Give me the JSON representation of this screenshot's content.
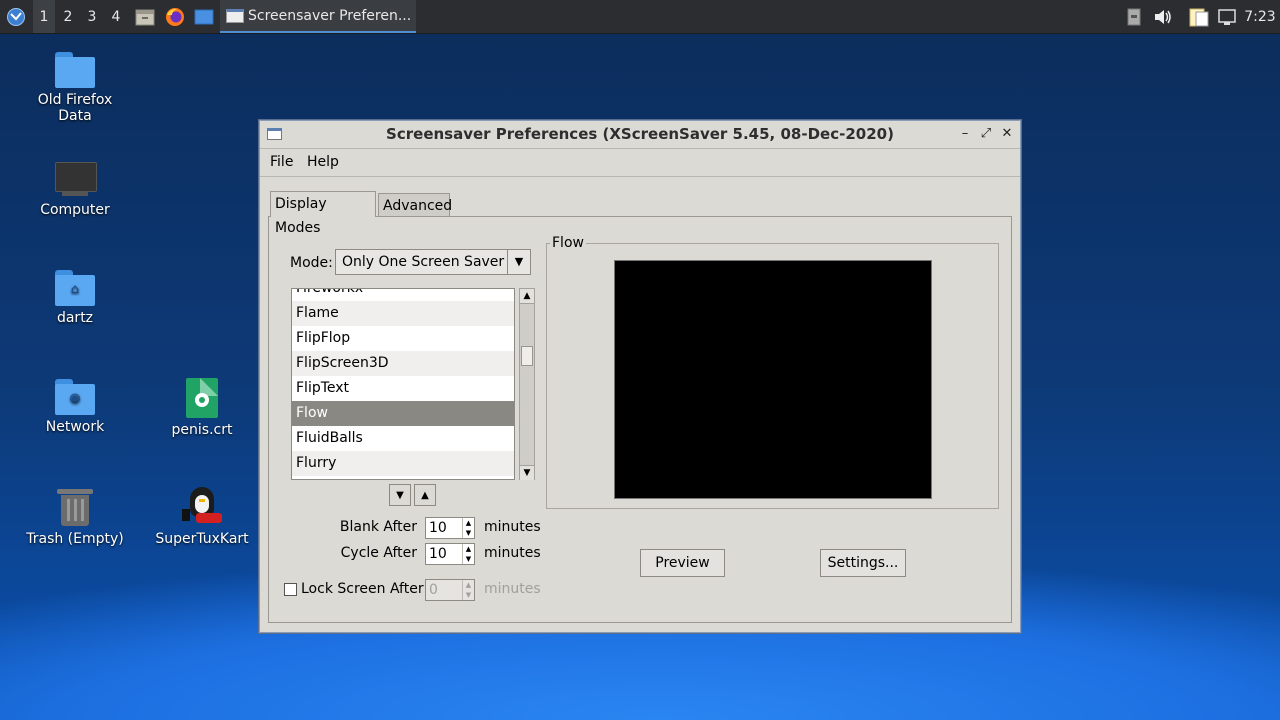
{
  "taskbar": {
    "workspaces": [
      "1",
      "2",
      "3",
      "4"
    ],
    "active_workspace": "1",
    "task_title": "Screensaver Preferen...",
    "clock": "7:23"
  },
  "desktop": {
    "icons": [
      {
        "label": "Old Firefox Data",
        "icon": "folder-icon"
      },
      {
        "label": "Computer",
        "icon": "monitor-icon"
      },
      {
        "label": "dartz",
        "icon": "home-folder-icon"
      },
      {
        "label": "Network",
        "icon": "network-folder-icon"
      },
      {
        "label": "penis.crt",
        "icon": "certificate-file-icon"
      },
      {
        "label": "Trash (Empty)",
        "icon": "trash-icon"
      },
      {
        "label": "SuperTuxKart",
        "icon": "supertuxkart-icon"
      }
    ]
  },
  "window": {
    "title": "Screensaver Preferences  (XScreenSaver 5.45, 08-Dec-2020)",
    "menu": {
      "file": "File",
      "help": "Help"
    },
    "tabs": {
      "display_modes": "Display Modes",
      "advanced": "Advanced"
    },
    "mode": {
      "label": "Mode:",
      "value": "Only One Screen Saver"
    },
    "list": {
      "items": [
        "Fireworkx",
        "Flame",
        "FlipFlop",
        "FlipScreen3D",
        "FlipText",
        "Flow",
        "FluidBalls",
        "Flurry"
      ],
      "selected": "Flow"
    },
    "blank_after": {
      "label": "Blank After",
      "value": "10",
      "unit": "minutes"
    },
    "cycle_after": {
      "label": "Cycle After",
      "value": "10",
      "unit": "minutes"
    },
    "lock_after": {
      "label": "Lock Screen After",
      "value": "0",
      "unit": "minutes",
      "checked": false
    },
    "preview": {
      "frame_title": "Flow",
      "preview_button": "Preview",
      "settings_button": "Settings..."
    }
  }
}
